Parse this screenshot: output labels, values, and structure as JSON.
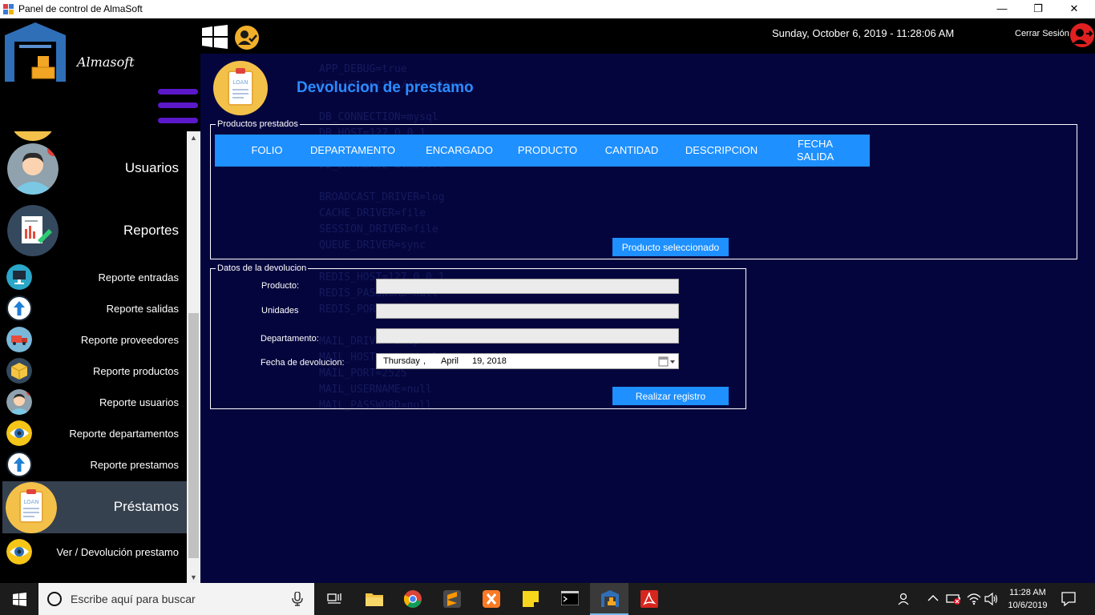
{
  "window": {
    "title": "Panel de control de AlmaSoft",
    "minimize": "—",
    "maximize": "❐",
    "close": "✕"
  },
  "header": {
    "datetime": "Sunday, October 6, 2019 - 11:28:06 AM",
    "logout_label": "Cerrar Sesión"
  },
  "sidebar": {
    "brand": "Almasoft",
    "items": [
      {
        "label": "Usuarios",
        "icon": "user-avatar-icon"
      },
      {
        "label": "Reportes",
        "icon": "report-icon"
      },
      {
        "label": "Reporte entradas",
        "icon": "monitor-icon"
      },
      {
        "label": "Reporte salidas",
        "icon": "arrow-up-icon"
      },
      {
        "label": "Reporte proveedores",
        "icon": "truck-icon"
      },
      {
        "label": "Reporte productos",
        "icon": "box-icon"
      },
      {
        "label": "Reporte usuarios",
        "icon": "user-icon"
      },
      {
        "label": "Reporte departamentos",
        "icon": "eye-icon"
      },
      {
        "label": "Reporte prestamos",
        "icon": "arrow-up-icon"
      },
      {
        "label": "Préstamos",
        "icon": "loan-icon"
      },
      {
        "label": "Ver / Devolución prestamo",
        "icon": "eye-icon"
      }
    ]
  },
  "main": {
    "title": "Devolucion de prestamo",
    "loan_icon_text": "LOAN",
    "loans_group": {
      "legend": "Productos prestados",
      "columns": [
        "FOLIO",
        "DEPARTAMENTO",
        "ENCARGADO",
        "PRODUCTO",
        "CANTIDAD",
        "DESCRIPCION",
        "FECHA SALIDA"
      ],
      "selected_button": "Producto seleccionado"
    },
    "return_group": {
      "legend": "Datos de la devolucion",
      "product_label": "Producto:",
      "product_value": "",
      "units_label": "Unidades",
      "units_value": "",
      "department_label": "Departamento:",
      "department_value": "",
      "date_label": "Fecha de devolucion:",
      "date_weekday": "Thursday",
      "date_sep": ",",
      "date_month": "April",
      "date_day_year": "19, 2018",
      "submit_button": "Realizar registro"
    }
  },
  "taskbar": {
    "search_placeholder": "Escribe aquí para buscar",
    "time": "11:28 AM",
    "date": "10/6/2019"
  }
}
